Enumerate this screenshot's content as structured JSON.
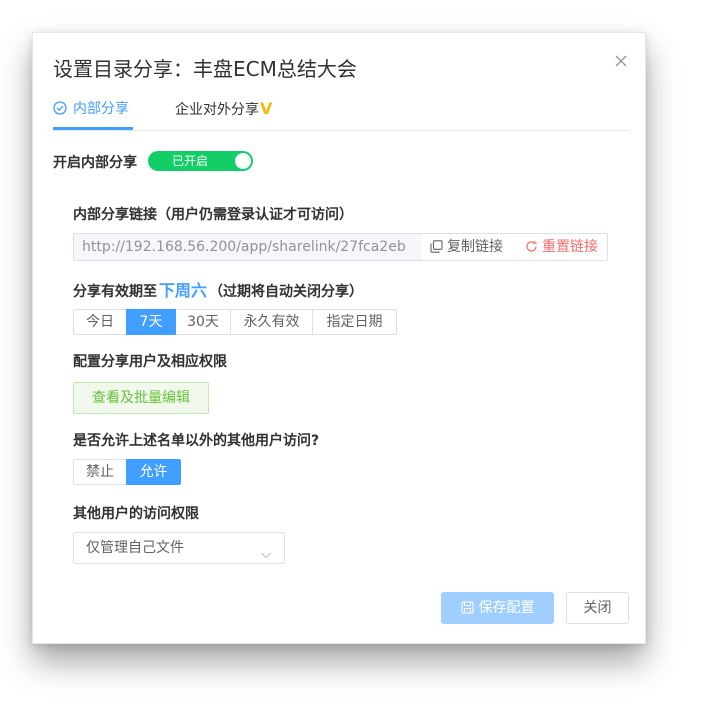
{
  "dialog": {
    "title": "设置目录分享：丰盘ECM总结大会",
    "close_icon": "close-icon"
  },
  "tabs": [
    {
      "label": "内部分享",
      "active": true,
      "icon": "check-circle-icon"
    },
    {
      "label": "企业对外分享",
      "badge": "V",
      "badge_color": "#f0b90b"
    }
  ],
  "internal_share": {
    "label": "开启内部分享",
    "switch_text": "已开启",
    "enabled": true,
    "switch_color": "#13ce66"
  },
  "share_link": {
    "label": "内部分享链接（用户仍需登录认证才可访问）",
    "url": "http://192.168.56.200/app/sharelink/27fca2eb",
    "copy_label": "复制链接",
    "reset_label": "重置链接"
  },
  "validity": {
    "label_prefix": "分享有效期至",
    "date": "下周六",
    "label_suffix": "（过期将自动关闭分享）",
    "options": [
      "今日",
      "7天",
      "30天",
      "永久有效",
      "指定日期"
    ],
    "selected": "7天"
  },
  "users": {
    "label": "配置分享用户及相应权限",
    "button_label": "查看及批量编辑"
  },
  "others_access": {
    "label": "是否允许上述名单以外的其他用户访问?",
    "options": [
      "禁止",
      "允许"
    ],
    "selected": "允许"
  },
  "others_permission": {
    "label": "其他用户的访问权限",
    "selected": "仅管理自己文件"
  },
  "footer": {
    "save_label": "保存配置",
    "close_label": "关闭"
  },
  "colors": {
    "accent": "#409eff",
    "danger": "#f56c6c",
    "success": "#67c23a"
  }
}
